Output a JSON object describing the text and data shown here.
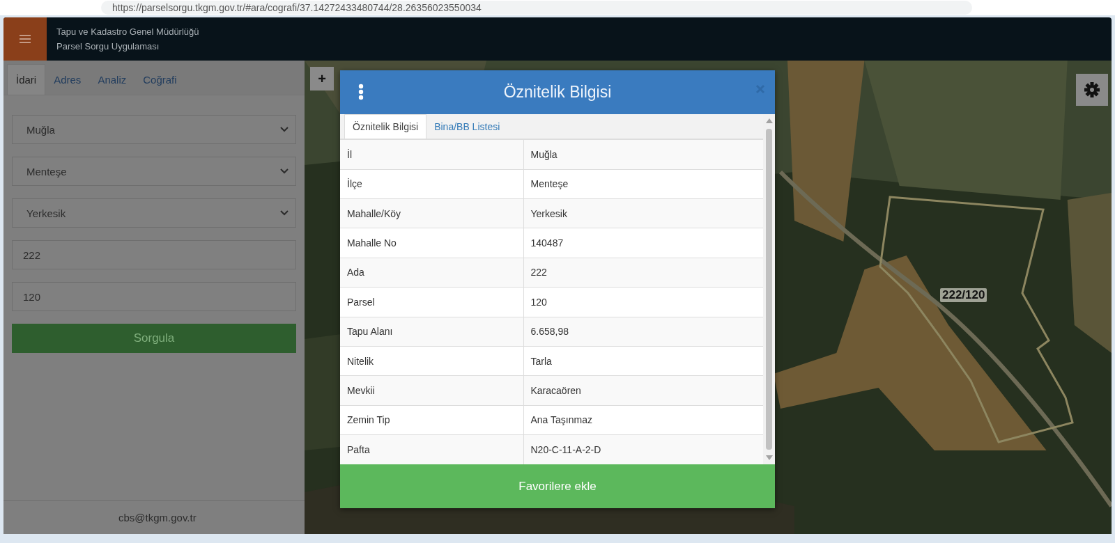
{
  "browser": {
    "url": "https://parselsorgu.tkgm.gov.tr/#ara/cografi/37.14272433480744/28.26356023550034"
  },
  "header": {
    "title": "Tapu ve Kadastro Genel Müdürlüğü",
    "subtitle": "Parsel Sorgu Uygulaması"
  },
  "sidebar": {
    "tabs": [
      {
        "label": "İdari",
        "selected": true
      },
      {
        "label": "Adres",
        "selected": false
      },
      {
        "label": "Analiz",
        "selected": false
      },
      {
        "label": "Coğrafi",
        "selected": false
      }
    ],
    "selects": [
      {
        "value": "Muğla"
      },
      {
        "value": "Menteşe"
      },
      {
        "value": "Yerkesik"
      }
    ],
    "inputs": [
      {
        "value": "222"
      },
      {
        "value": "120"
      }
    ],
    "button": "Sorgula",
    "footer": "cbs@tkgm.gov.tr"
  },
  "map": {
    "kind": "picture",
    "zoom_in": "+",
    "parcel_label": "222/120"
  },
  "dialog": {
    "title": "Öznitelik Bilgisi",
    "tabs": [
      {
        "label": "Öznitelik Bilgisi",
        "selected": true
      },
      {
        "label": "Bina/BB Listesi",
        "selected": false
      }
    ],
    "rows": [
      {
        "label": "İl",
        "value": "Muğla"
      },
      {
        "label": "İlçe",
        "value": "Menteşe"
      },
      {
        "label": "Mahalle/Köy",
        "value": "Yerkesik"
      },
      {
        "label": "Mahalle No",
        "value": "140487"
      },
      {
        "label": "Ada",
        "value": "222"
      },
      {
        "label": "Parsel",
        "value": "120"
      },
      {
        "label": "Tapu Alanı",
        "value": "6.658,98"
      },
      {
        "label": "Nitelik",
        "value": "Tarla"
      },
      {
        "label": "Mevkii",
        "value": "Karacaören"
      },
      {
        "label": "Zemin Tip",
        "value": "Ana Taşınmaz"
      },
      {
        "label": "Pafta",
        "value": "N20-C-11-A-2-D"
      }
    ],
    "button": "Favorilere ekle"
  }
}
